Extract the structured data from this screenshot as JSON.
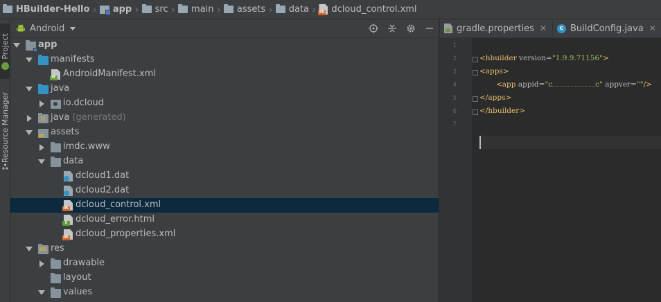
{
  "breadcrumb": [
    {
      "label": "HBuilder-Hello",
      "icon": "project-folder-icon",
      "bold": true
    },
    {
      "label": "app",
      "icon": "module-folder-icon",
      "bold": true
    },
    {
      "label": "src",
      "icon": "folder-icon",
      "bold": false
    },
    {
      "label": "main",
      "icon": "folder-icon",
      "bold": false
    },
    {
      "label": "assets",
      "icon": "assets-folder-icon",
      "bold": false
    },
    {
      "label": "data",
      "icon": "folder-icon",
      "bold": false
    },
    {
      "label": "dcloud_control.xml",
      "icon": "xml-file-icon",
      "bold": false
    }
  ],
  "tool_strip": {
    "project_tab": "1: Project",
    "resource_tab": "Resource Manager"
  },
  "project_panel": {
    "view_selected": "Android",
    "tools": [
      "locate-target-icon",
      "collapse-all-icon",
      "gear-icon",
      "minimize-icon"
    ]
  },
  "tree": [
    {
      "label": "app",
      "depth": 0,
      "arrow": "down",
      "icon": "module-folder-icon",
      "bold": true
    },
    {
      "label": "manifests",
      "depth": 1,
      "arrow": "down",
      "icon": "folder-blue-icon"
    },
    {
      "label": "AndroidManifest.xml",
      "depth": 2,
      "arrow": "none",
      "icon": "manifest-file-icon"
    },
    {
      "label": "java",
      "depth": 1,
      "arrow": "down",
      "icon": "folder-blue-icon"
    },
    {
      "label": "io.dcloud",
      "depth": 2,
      "arrow": "right",
      "icon": "package-icon"
    },
    {
      "label": "java",
      "suffix": "(generated)",
      "depth": 1,
      "arrow": "right",
      "icon": "generated-folder-icon"
    },
    {
      "label": "assets",
      "depth": 1,
      "arrow": "down",
      "icon": "assets-folder-icon"
    },
    {
      "label": "imdc.www",
      "depth": 2,
      "arrow": "right",
      "icon": "folder-icon"
    },
    {
      "label": "data",
      "depth": 2,
      "arrow": "down",
      "icon": "folder-icon"
    },
    {
      "label": "dcloud1.dat",
      "depth": 3,
      "arrow": "none",
      "icon": "unknown-file-icon"
    },
    {
      "label": "dcloud2.dat",
      "depth": 3,
      "arrow": "none",
      "icon": "unknown-file-icon"
    },
    {
      "label": "dcloud_control.xml",
      "depth": 3,
      "arrow": "none",
      "icon": "xml-file-icon",
      "selected": true
    },
    {
      "label": "dcloud_error.html",
      "depth": 3,
      "arrow": "none",
      "icon": "html-file-icon"
    },
    {
      "label": "dcloud_properties.xml",
      "depth": 3,
      "arrow": "none",
      "icon": "xml-file-icon"
    },
    {
      "label": "res",
      "depth": 1,
      "arrow": "down",
      "icon": "res-folder-icon"
    },
    {
      "label": "drawable",
      "depth": 2,
      "arrow": "right",
      "icon": "folder-icon"
    },
    {
      "label": "layout",
      "depth": 2,
      "arrow": "none",
      "icon": "folder-icon"
    },
    {
      "label": "values",
      "depth": 2,
      "arrow": "down",
      "icon": "folder-icon"
    }
  ],
  "editor": {
    "tabs": [
      {
        "label": "gradle.properties",
        "icon": "properties-file-icon"
      },
      {
        "label": "BuildConfig.java",
        "icon": "java-class-icon"
      },
      {
        "label": "",
        "icon": "manifest-file-icon"
      }
    ],
    "line_numbers": [
      "1",
      "2",
      "3",
      "4",
      "5",
      "6",
      "7"
    ],
    "code": {
      "l2_tag": "<hbuilder",
      "l2_attr": " version=",
      "l2_val": "\"1.9.9.71156\"",
      "l2_end": ">",
      "l3": "<apps>",
      "l4_tag": "<app",
      "l4_attr1": " appid=",
      "l4_val1": "\"c",
      "l4_val1_end": "c\"",
      "l4_attr2": " appver=",
      "l4_val2": "\"\"",
      "l4_end": "/>",
      "l5": "</apps>",
      "l6": "</hbuilder>"
    }
  },
  "colors": {
    "selection": "#0d293e",
    "panel": "#3c3f41",
    "editor_bg": "#2b2b2b",
    "xml_tag": "#e8bf6a",
    "xml_value": "#a5c25c"
  }
}
